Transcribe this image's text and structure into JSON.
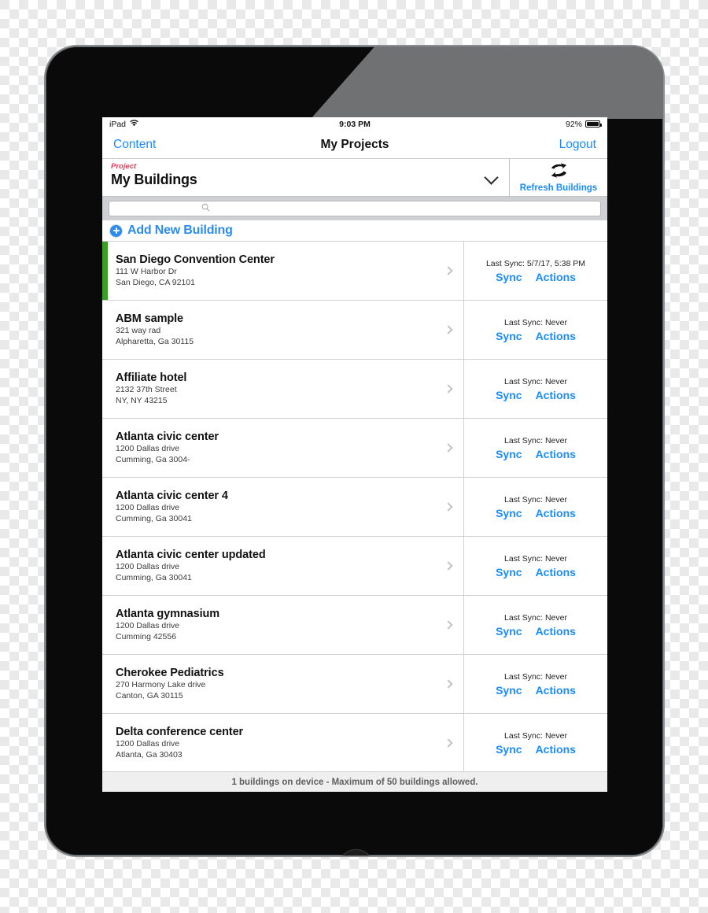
{
  "device": {
    "name": "iPad"
  },
  "statusbar": {
    "carrier": "iPad",
    "wifi_icon": "wifi-icon",
    "time": "9:03 PM",
    "battery_percent": "92%",
    "battery_icon": "battery-full-icon"
  },
  "navbar": {
    "back_label": "Content",
    "title": "My Projects",
    "logout_label": "Logout"
  },
  "project": {
    "label": "Project",
    "value": "My Buildings",
    "chevron_icon": "chevron-down-icon",
    "refresh": {
      "label": "Refresh Buildings",
      "icon": "refresh-sync-icon"
    }
  },
  "search": {
    "value": "",
    "placeholder": "",
    "icon": "search-icon"
  },
  "add_row": {
    "label": "Add New Building",
    "icon": "plus-circle-icon"
  },
  "colors": {
    "link_blue": "#1a8cff",
    "accent_green": "#3a9e27",
    "project_label_red": "#e0415c",
    "footer_text": "#5f5f5f"
  },
  "list": {
    "sync_label": "Sync",
    "actions_label": "Actions",
    "chevron_icon": "chevron-right-icon",
    "rows": [
      {
        "name": "San Diego Convention Center",
        "street": "111 W Harbor Dr",
        "citystate": "San Diego, CA 92101",
        "last_sync": "Last Sync: 5/7/17, 5:38 PM",
        "synced": true
      },
      {
        "name": "ABM sample",
        "street": "321 way rad",
        "citystate": "Alpharetta, Ga 30115",
        "last_sync": "Last Sync: Never",
        "synced": false
      },
      {
        "name": "Affiliate hotel",
        "street": "2132 37th Street",
        "citystate": "NY, NY 43215",
        "last_sync": "Last Sync: Never",
        "synced": false
      },
      {
        "name": "Atlanta civic center",
        "street": "1200 Dallas drive",
        "citystate": "Cumming, Ga 3004-",
        "last_sync": "Last Sync: Never",
        "synced": false
      },
      {
        "name": "Atlanta civic center 4",
        "street": "1200 Dallas drive",
        "citystate": "Cumming, Ga 30041",
        "last_sync": "Last Sync: Never",
        "synced": false
      },
      {
        "name": "Atlanta civic center updated",
        "street": "1200 Dallas drive",
        "citystate": "Cumming, Ga 30041",
        "last_sync": "Last Sync: Never",
        "synced": false
      },
      {
        "name": "Atlanta gymnasium",
        "street": "1200 Dallas drive",
        "citystate": "Cumming 42556",
        "last_sync": "Last Sync: Never",
        "synced": false
      },
      {
        "name": "Cherokee Pediatrics",
        "street": "270 Harmony Lake drive",
        "citystate": "Canton, GA 30115",
        "last_sync": "Last Sync: Never",
        "synced": false
      },
      {
        "name": "Delta conference center",
        "street": "1200 Dallas drive",
        "citystate": "Atlanta, Ga 30403",
        "last_sync": "Last Sync: Never",
        "synced": false
      }
    ]
  },
  "footer": {
    "text": "1 buildings on device - Maximum of 50 buildings allowed."
  }
}
